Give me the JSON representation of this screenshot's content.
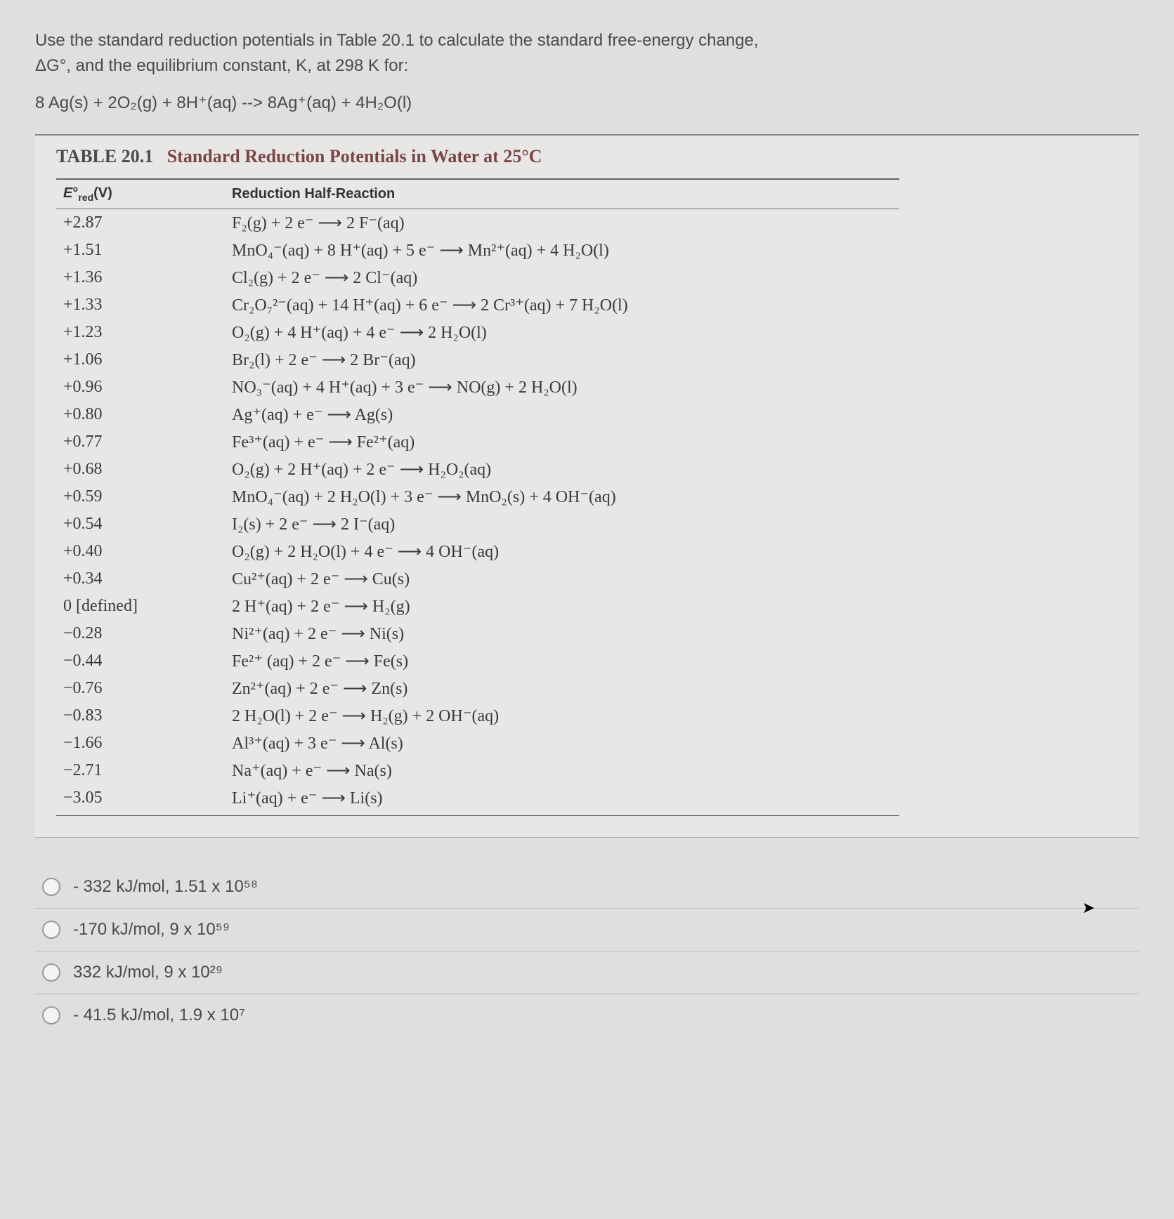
{
  "question": {
    "line1": "Use the standard reduction potentials in Table 20.1 to calculate the standard free-energy change,",
    "line2": "ΔG°, and the equilibrium constant, K, at 298 K for:",
    "equation": "8 Ag(s) + 2O₂(g) + 8H⁺(aq) -->  8Ag⁺(aq) + 4H₂O(l)"
  },
  "table": {
    "number": "TABLE 20.1",
    "title": "Standard Reduction Potentials in Water at 25°C",
    "headers": {
      "col1": "E°red(V)",
      "col2": "Reduction Half-Reaction"
    },
    "rows": [
      {
        "e": "+2.87",
        "rx": "F₂(g) + 2 e⁻ ⟶ 2 F⁻(aq)"
      },
      {
        "e": "+1.51",
        "rx": "MnO₄⁻(aq) + 8 H⁺(aq) + 5 e⁻ ⟶ Mn²⁺(aq) + 4 H₂O(l)"
      },
      {
        "e": "+1.36",
        "rx": "Cl₂(g) + 2 e⁻ ⟶ 2 Cl⁻(aq)"
      },
      {
        "e": "+1.33",
        "rx": "Cr₂O₇²⁻(aq) + 14 H⁺(aq) + 6 e⁻ ⟶ 2 Cr³⁺(aq) + 7 H₂O(l)"
      },
      {
        "e": "+1.23",
        "rx": "O₂(g) + 4 H⁺(aq) + 4 e⁻ ⟶ 2 H₂O(l)"
      },
      {
        "e": "+1.06",
        "rx": "Br₂(l) + 2 e⁻ ⟶ 2 Br⁻(aq)"
      },
      {
        "e": "+0.96",
        "rx": "NO₃⁻(aq) + 4 H⁺(aq) + 3 e⁻ ⟶ NO(g) + 2 H₂O(l)"
      },
      {
        "e": "+0.80",
        "rx": "Ag⁺(aq) + e⁻ ⟶ Ag(s)"
      },
      {
        "e": "+0.77",
        "rx": "Fe³⁺(aq) + e⁻ ⟶ Fe²⁺(aq)"
      },
      {
        "e": "+0.68",
        "rx": "O₂(g) + 2 H⁺(aq) + 2 e⁻ ⟶ H₂O₂(aq)"
      },
      {
        "e": "+0.59",
        "rx": "MnO₄⁻(aq) + 2 H₂O(l) + 3 e⁻ ⟶ MnO₂(s) + 4 OH⁻(aq)"
      },
      {
        "e": "+0.54",
        "rx": "I₂(s) + 2 e⁻ ⟶ 2 I⁻(aq)"
      },
      {
        "e": "+0.40",
        "rx": "O₂(g) + 2 H₂O(l) + 4 e⁻ ⟶ 4 OH⁻(aq)"
      },
      {
        "e": "+0.34",
        "rx": "Cu²⁺(aq) + 2 e⁻ ⟶ Cu(s)"
      },
      {
        "e": "0 [defined]",
        "rx": "2 H⁺(aq) + 2 e⁻ ⟶ H₂(g)"
      },
      {
        "e": "−0.28",
        "rx": "Ni²⁺(aq) + 2 e⁻ ⟶ Ni(s)"
      },
      {
        "e": "−0.44",
        "rx": "Fe²⁺ (aq) + 2 e⁻ ⟶ Fe(s)"
      },
      {
        "e": "−0.76",
        "rx": "Zn²⁺(aq) + 2 e⁻ ⟶ Zn(s)"
      },
      {
        "e": "−0.83",
        "rx": "2 H₂O(l) + 2 e⁻ ⟶ H₂(g) + 2 OH⁻(aq)"
      },
      {
        "e": "−1.66",
        "rx": "Al³⁺(aq) + 3 e⁻ ⟶ Al(s)"
      },
      {
        "e": "−2.71",
        "rx": "Na⁺(aq) + e⁻ ⟶ Na(s)"
      },
      {
        "e": "−3.05",
        "rx": "Li⁺(aq) + e⁻ ⟶ Li(s)"
      }
    ]
  },
  "options": [
    "- 332 kJ/mol, 1.51 x 10⁵⁸",
    "-170 kJ/mol, 9 x 10⁵⁹",
    "332 kJ/mol, 9 x 10²⁹",
    "- 41.5 kJ/mol, 1.9 x 10⁷"
  ]
}
